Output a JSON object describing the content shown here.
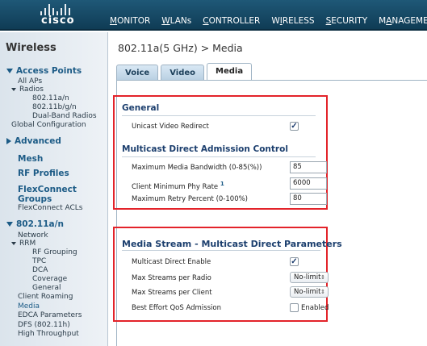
{
  "brand": {
    "logo_text": "cisco"
  },
  "nav": {
    "items": [
      {
        "pre": "",
        "u": "M",
        "post": "ONITOR"
      },
      {
        "pre": "",
        "u": "W",
        "post": "LANs"
      },
      {
        "pre": "",
        "u": "C",
        "post": "ONTROLLER"
      },
      {
        "pre": "W",
        "u": "I",
        "post": "RELESS"
      },
      {
        "pre": "",
        "u": "S",
        "post": "ECURITY"
      },
      {
        "pre": "M",
        "u": "A",
        "post": "NAGEMENT"
      }
    ]
  },
  "sidebar": {
    "title": "Wireless",
    "access_points": "Access Points",
    "all_aps": "All APs",
    "radios": "Radios",
    "r_an": "802.11a/n",
    "r_bgn": "802.11b/g/n",
    "r_dual": "Dual-Band Radios",
    "global_config": "Global Configuration",
    "advanced": "Advanced",
    "mesh": "Mesh",
    "rf_profiles": "RF Profiles",
    "flexconnect_groups_1": "FlexConnect",
    "flexconnect_groups_2": "Groups",
    "flexconnect_acls": "FlexConnect ACLs",
    "band_an": "802.11a/n",
    "network": "Network",
    "rrm": "RRM",
    "rf_grouping": "RF Grouping",
    "tpc": "TPC",
    "dca": "DCA",
    "coverage": "Coverage",
    "general": "General",
    "client_roaming": "Client Roaming",
    "media": "Media",
    "edca": "EDCA Parameters",
    "dfs": "DFS (802.11h)",
    "high_throughput": "High Throughput"
  },
  "main": {
    "title": "802.11a(5 GHz) > Media",
    "tabs": [
      "Voice",
      "Video",
      "Media"
    ],
    "general": {
      "heading": "General",
      "unicast_video_redirect": "Unicast Video Redirect",
      "unicast_checked": true
    },
    "mdac": {
      "heading": "Multicast Direct Admission Control",
      "max_bw_label": "Maximum Media Bandwidth (0-85(%))",
      "max_bw_value": "85",
      "min_phy_label": "Client Minimum Phy Rate",
      "min_phy_sup": "1",
      "min_phy_value": "6000",
      "max_retry_label": "Maximum Retry Percent (0-100%)",
      "max_retry_value": "80"
    },
    "media_stream": {
      "heading": "Media Stream - Multicast Direct Parameters",
      "mc_enable_label": "Multicast Direct Enable",
      "mc_enable_checked": true,
      "max_radio_label": "Max Streams per Radio",
      "max_radio_value": "No-limit",
      "max_client_label": "Max Streams per Client",
      "max_client_value": "No-limit",
      "qos_label": "Best Effort QoS Admission",
      "qos_enabled_label": "Enabled",
      "qos_checked": false
    }
  },
  "colors": {
    "highlight_box": "#e3232a",
    "topbar": "#1f5877"
  }
}
